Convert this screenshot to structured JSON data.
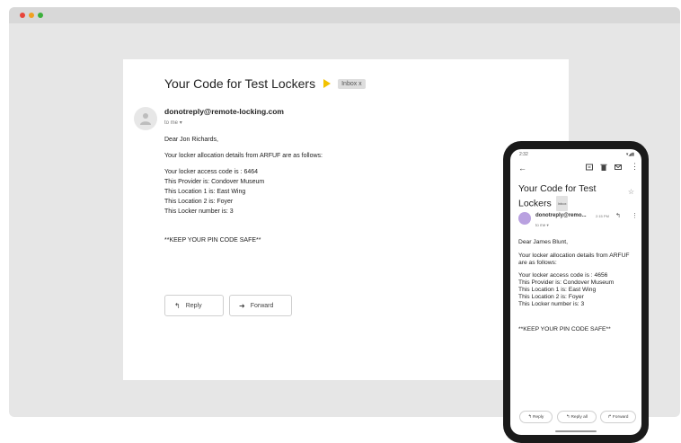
{
  "window": {
    "colors": {
      "close": "#e8443a",
      "minimize": "#f0a020",
      "maximize": "#3cb03c"
    }
  },
  "desktop_email": {
    "subject": "Your Code for Test Lockers",
    "label": "Inbox",
    "sender": "donotreply@remote-locking.com",
    "to": "to me",
    "lines": [
      "Dear Jon Richards,",
      "",
      "Your locker allocation details from ARFUF are as follows:",
      "",
      "Your locker access code is : 6464",
      "This Provider is: Condover Museum",
      "This Location 1 is: East Wing",
      "This Location 2 is: Foyer",
      "This Locker number is: 3",
      "",
      "",
      "",
      "**KEEP YOUR PIN CODE SAFE**"
    ],
    "reply_label": "Reply",
    "forward_label": "Forward"
  },
  "phone_email": {
    "status_time": "2:32",
    "subject": "Your Code for Test Lockers",
    "label": "Inbox",
    "sender": "donotreply@remo...",
    "time": "2:15 PM",
    "to": "to me",
    "lines": [
      "Dear James Blunt,",
      "",
      "Your locker allocation details from ARFUF are as follows:",
      "",
      "Your locker access code is : 4656",
      "This Provider is: Condover Museum",
      "This Location 1 is: East Wing",
      "This Location 2 is: Foyer",
      "This Locker number is: 3",
      "",
      "",
      "",
      "**KEEP YOUR PIN CODE SAFE**"
    ],
    "reply_label": "Reply",
    "reply_all_label": "Reply all",
    "forward_label": "Forward"
  }
}
